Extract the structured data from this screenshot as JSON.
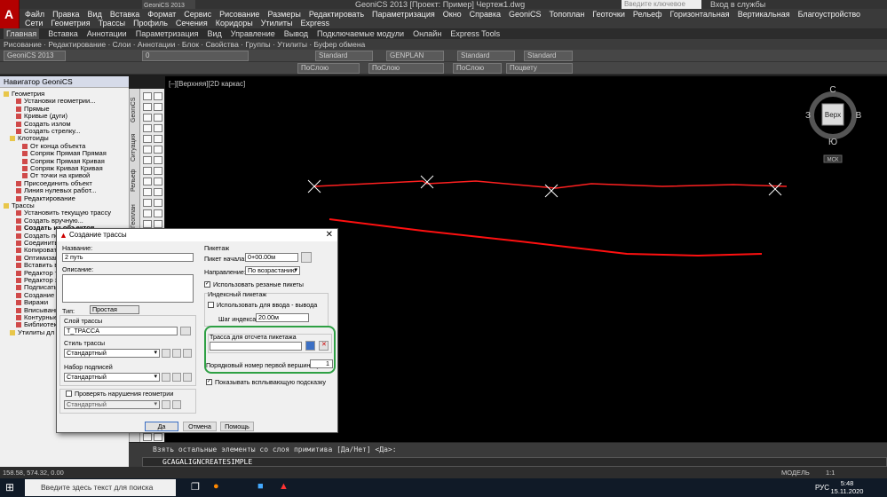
{
  "titlebar": {
    "title": "GeoniCS 2013 [Проект: Пример]  Чертеж1.dwg",
    "quick_access": "GeoniCS 2013",
    "search_placeholder": "Введите ключевое слово/фразу",
    "login": "Вход в службы"
  },
  "menubar": {
    "items": [
      "Файл",
      "Правка",
      "Вид",
      "Вставка",
      "Формат",
      "Сервис",
      "Рисование",
      "Размеры",
      "Редактировать",
      "Параметризация",
      "Окно",
      "Справка",
      "GeoniCS",
      "Топоплан",
      "Геоточки",
      "Рельеф",
      "Горизонтальная",
      "Вертикальная",
      "Благоустройство",
      "Сети",
      "Геометрия",
      "Трассы",
      "Профиль",
      "Сечения",
      "Коридоры",
      "Утилиты",
      "Express"
    ]
  },
  "ribbon": {
    "tabs": [
      "Главная",
      "Вставка",
      "Аннотации",
      "Параметризация",
      "Вид",
      "Управление",
      "Вывод",
      "Подключаемые модули",
      "Онлайн",
      "Express Tools"
    ],
    "panels": "Рисование · Редактирование · Слои · Аннотации · Блок · Свойства · Группы · Утилиты · Буфер обмена"
  },
  "toolbars": {
    "workspace": "GeoniCS 2013",
    "layer": "0",
    "textstyle": "Standard",
    "dimstyle": "GENPLAN",
    "tablestyle": "Standard",
    "mleaderstyle": "Standard",
    "color": "ПоСлою",
    "linetype": "ПоСлою",
    "lineweight": "ПоСлою",
    "plotstyle": "Поцвету"
  },
  "navigator": {
    "title": "Навигатор GeoniCS",
    "items": [
      {
        "label": "Геометрия",
        "indent": 0
      },
      {
        "label": "Установки геометрии...",
        "indent": 2
      },
      {
        "label": "Прямые",
        "indent": 2
      },
      {
        "label": "Кривые (дуги)",
        "indent": 2
      },
      {
        "label": "Создать излом",
        "indent": 2
      },
      {
        "label": "Создать стрелку...",
        "indent": 2
      },
      {
        "label": "Клотоиды",
        "indent": 1
      },
      {
        "label": "От конца объекта",
        "indent": 3
      },
      {
        "label": "Сопряж Прямая Прямая",
        "indent": 3
      },
      {
        "label": "Сопряж Прямая Кривая",
        "indent": 3
      },
      {
        "label": "Сопряж Кривая Кривая",
        "indent": 3
      },
      {
        "label": "От точки на кривой",
        "indent": 3
      },
      {
        "label": "Присоединить объект",
        "indent": 2
      },
      {
        "label": "Линия нулевых работ...",
        "indent": 2
      },
      {
        "label": "Редактирование",
        "indent": 2
      },
      {
        "label": "Трассы",
        "indent": 0
      },
      {
        "label": "Установить текущую трассу",
        "indent": 2
      },
      {
        "label": "Создать вручную...",
        "indent": 2
      },
      {
        "label": "Создать из объектов",
        "indent": 2
      },
      {
        "label": "Создать по",
        "indent": 2
      },
      {
        "label": "Соединить т",
        "indent": 2
      },
      {
        "label": "Копировать",
        "indent": 2
      },
      {
        "label": "Оптимизац",
        "indent": 2
      },
      {
        "label": "Вставить в",
        "indent": 2
      },
      {
        "label": "Редактор т",
        "indent": 2
      },
      {
        "label": "Редактор э",
        "indent": 2
      },
      {
        "label": "Подписать",
        "indent": 2
      },
      {
        "label": "Создание в",
        "indent": 2
      },
      {
        "label": "Виражи",
        "indent": 2
      },
      {
        "label": "Вписывани",
        "indent": 2
      },
      {
        "label": "Контурные",
        "indent": 2
      },
      {
        "label": "Библиотек",
        "indent": 2
      },
      {
        "label": "Утилиты дл",
        "indent": 1
      }
    ]
  },
  "side_tabs": [
    "GeoniCS",
    "Ситуация",
    "Рельеф",
    "Геоплан"
  ],
  "canvas": {
    "view_label": "[–][Верхняя][2D каркас]",
    "viewcube": {
      "top": "Верх",
      "n": "С",
      "s": "Ю",
      "w": "З",
      "e": "В",
      "wcs": "МСК"
    }
  },
  "command": {
    "history": "Взять остальные элементы со слоя примитива [Да/Нет] <Да>:",
    "input": "GCAGALIGNCREATESIMPLE",
    "coords": "158.58, 574.32, 0.00",
    "model_tab": "МОДЕЛЬ",
    "scale": "1:1"
  },
  "taskbar": {
    "search_placeholder": "Введите здесь текст для поиска",
    "lang": "РУС",
    "time": "5:48",
    "date": "15.11.2020"
  },
  "dialog": {
    "title": "Создание трассы",
    "name_label": "Название:",
    "name_value": "2 путь",
    "desc_label": "Описание:",
    "desc_value": "",
    "type_label": "Тип:",
    "type_value": "Простая",
    "layer_label": "Слой трассы",
    "layer_value": "T_TPACCA",
    "style_label": "Стиль трассы",
    "style_value": "Стандартный",
    "labels_label": "Набор подписей",
    "labels_value": "Стандартный",
    "check_geom_label": "Проверять нарушения геометрии",
    "check_geom_value": "Стандартный",
    "picket_label": "Пикетаж",
    "picket_start_label": "Пикет начала:",
    "picket_start_value": "0+00.00м",
    "direction_label": "Направление:",
    "direction_value": "По возрастанию",
    "use_cut_label": "Использовать резаные пикеты",
    "index_label": "Индексный пикетаж",
    "use_io_label": "Использовать для ввода - вывода",
    "index_step_label": "Шаг индекса:",
    "index_step_value": "20.00м",
    "ref_align_label": "Трасса для отсчета пикетажа",
    "ref_align_value": "",
    "vertex_label": "Порядковый номер первой вершины угла:",
    "vertex_value": "1",
    "tooltip_label": "Показывать всплывающую подсказку",
    "ok": "Да",
    "cancel": "Отмена",
    "help": "Помощь"
  },
  "colors": {
    "alignment_red": "#ff2020",
    "highlight_green": "#2ea044"
  }
}
